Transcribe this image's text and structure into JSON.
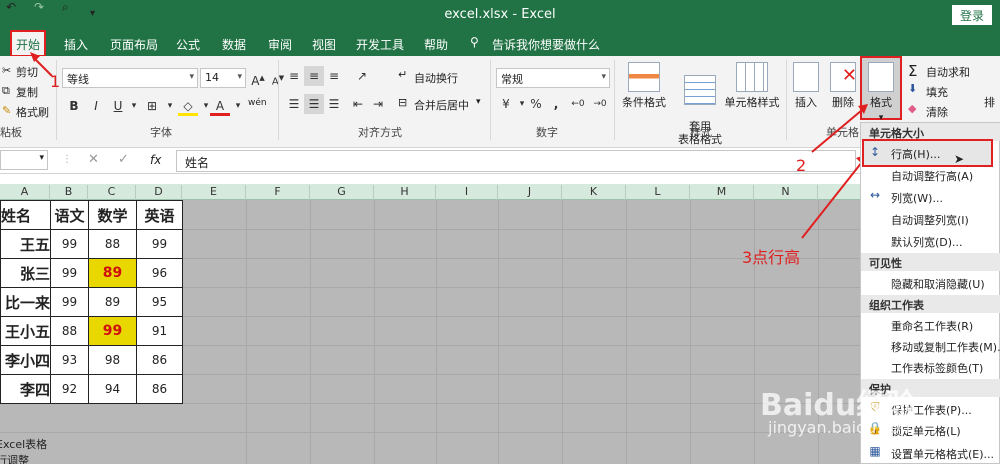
{
  "window": {
    "title": "excel.xlsx  -  Excel",
    "login": "登录"
  },
  "tabs": [
    "开始",
    "插入",
    "页面布局",
    "公式",
    "数据",
    "审阅",
    "视图",
    "开发工具",
    "帮助",
    "告诉我你想要做什么"
  ],
  "ribbon": {
    "clipboard": {
      "cut": "剪切",
      "copy": "复制",
      "painter": "格式刷",
      "label": "粘板"
    },
    "font": {
      "name": "等线",
      "size": "14",
      "bold": "B",
      "italic": "I",
      "underline": "U",
      "wen": "wén",
      "label": "字体"
    },
    "alignment": {
      "wrap": "自动换行",
      "merge": "合并后居中",
      "label": "对齐方式"
    },
    "number": {
      "format": "常规",
      "percent": "%",
      "comma": ",",
      "label": "数字"
    },
    "styles": {
      "conditional": "条件格式",
      "table_format": "套用\n表格格式",
      "cell_styles": "单元格样式",
      "label": "样式"
    },
    "cells": {
      "insert": "插入",
      "delete": "删除",
      "format": "格式",
      "label": "单元格"
    },
    "editing": {
      "autosum": "自动求和",
      "fill": "填充",
      "clear": "清除",
      "sort": "排"
    }
  },
  "formula_bar": {
    "fx": "fx",
    "value": "姓名"
  },
  "columns": [
    "A",
    "B",
    "C",
    "D",
    "E",
    "F",
    "G",
    "H",
    "I",
    "J",
    "K",
    "L",
    "M",
    "N"
  ],
  "table": {
    "headers": [
      "姓名",
      "语文",
      "数学",
      "英语"
    ],
    "rows": [
      [
        "王五",
        "99",
        "88",
        "99"
      ],
      [
        "张三",
        "99",
        "89",
        "96"
      ],
      [
        "比一来",
        "99",
        "89",
        "95"
      ],
      [
        "王小五",
        "88",
        "99",
        "91"
      ],
      [
        "李小四",
        "93",
        "98",
        "86"
      ],
      [
        "李四",
        "92",
        "94",
        "86"
      ]
    ]
  },
  "below_text": [
    "Excel表格",
    "行调整"
  ],
  "format_menu": {
    "sec_cellsize": "单元格大小",
    "row_height": "行高(H)...",
    "autofit_row": "自动调整行高(A)",
    "col_width": "列宽(W)...",
    "autofit_col": "自动调整列宽(I)",
    "default_width": "默认列宽(D)...",
    "sec_visibility": "可见性",
    "hide_unhide": "隐藏和取消隐藏(U)",
    "sec_organize": "组织工作表",
    "rename": "重命名工作表(R)",
    "move_copy": "移动或复制工作表(M)...",
    "tab_color": "工作表标签颜色(T)",
    "sec_protect": "保护",
    "protect_sheet": "保护工作表(P)...",
    "lock_cell": "锁定单元格(L)",
    "format_cells": "设置单元格格式(E)..."
  },
  "annotations": {
    "step1": "1",
    "step2": "2",
    "step3": "3点行高"
  },
  "watermark": {
    "brand": "Baidu经验",
    "url": "jingyan.baidu.com"
  }
}
